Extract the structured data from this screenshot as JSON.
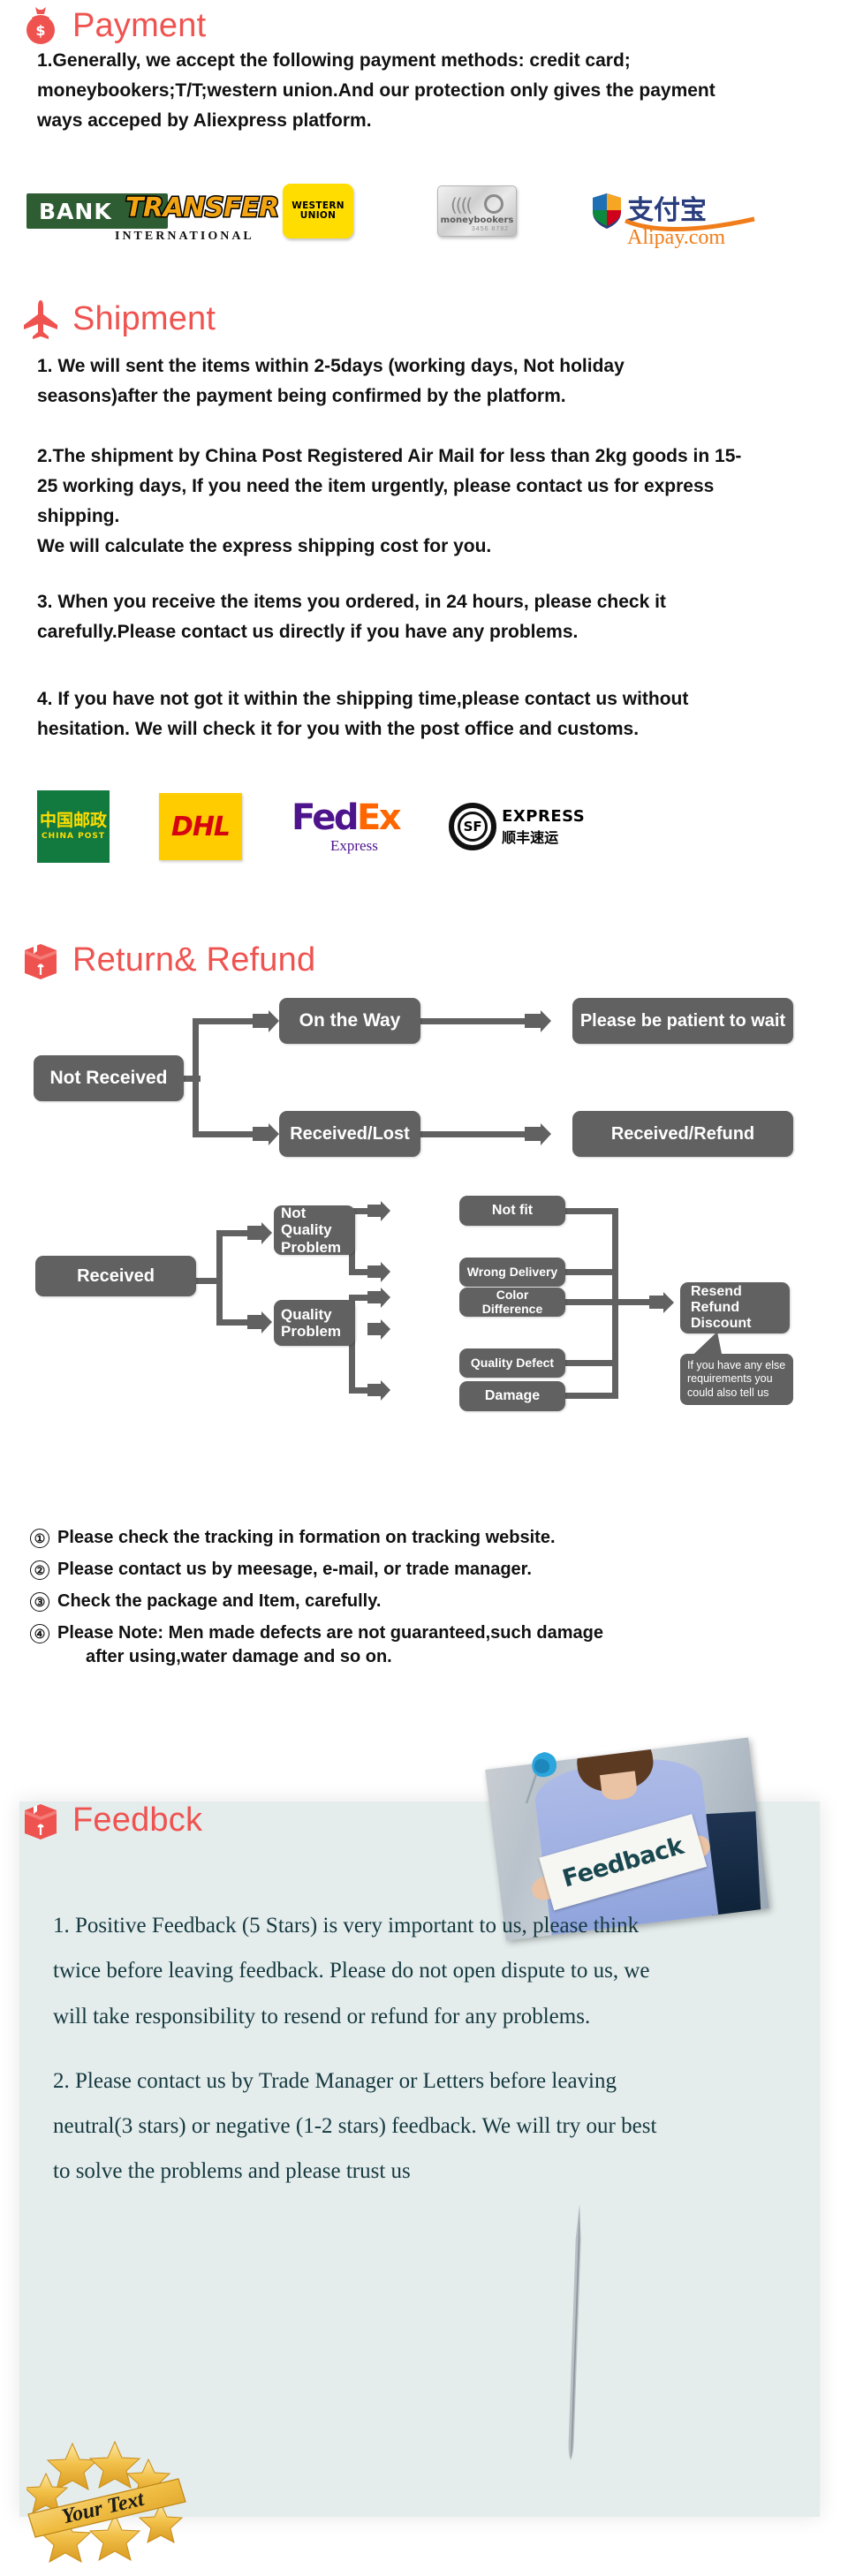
{
  "brand": {
    "accent": "#ef5350",
    "node_fill": "#616161",
    "feedback_card_bg": "#e4ecec",
    "feedback_text_color": "#15393f"
  },
  "sections": {
    "payment": {
      "title": "Payment",
      "icon": "money-bag-icon",
      "paragraph": "1.Generally, we accept the following payment methods: credit card; moneybookers;T/T;western union.And our protection only gives the payment ways acceped by Aliexpress platform.",
      "logos": [
        {
          "name": "bank-transfer-logo",
          "primary": "BANK",
          "secondary": "TRANSFER",
          "sub": "INTERNATIONAL"
        },
        {
          "name": "western-union-logo",
          "line1": "WESTERN",
          "line2": "UNION"
        },
        {
          "name": "moneybookers-logo",
          "label": "moneybookers",
          "number": "3456 8792"
        },
        {
          "name": "alipay-logo",
          "cn": "支付宝",
          "latin": "Alipay.com"
        }
      ]
    },
    "shipment": {
      "title": "Shipment",
      "icon": "airplane-icon",
      "paragraphs": [
        "1. We will sent the items within 2-5days (working days, Not holiday seasons)after the payment being confirmed by the platform.",
        "2.The shipment by China Post Registered Air Mail for less than  2kg goods in 15-25 working days, If  you need the item urgently, please contact us for express shipping.\nWe will calculate the express shipping cost for you.",
        "3. When you receive the items you ordered, in 24 hours, please check it carefully.Please contact us directly if you have any problems.",
        "4. If you have not got it within the shipping time,please contact us without hesitation. We will check it for you with the post office and customs."
      ],
      "carriers": [
        {
          "name": "china-post-logo",
          "cn": "中国邮政",
          "en": "CHINA POST"
        },
        {
          "name": "dhl-logo",
          "text": "DHL"
        },
        {
          "name": "fedex-logo",
          "part1": "Fed",
          "part2": "Ex",
          "sub": "Express"
        },
        {
          "name": "sf-express-logo",
          "mark": "SF",
          "en": "EXPRESS",
          "cn": "顺丰速运"
        }
      ]
    },
    "return_refund": {
      "title": "Return& Refund",
      "icon": "return-box-icon",
      "chart_data": {
        "type": "diagram",
        "title": "Return & Refund decision flow",
        "flows": [
          {
            "root": "Not Received",
            "branches": [
              {
                "node": "On the Way",
                "result": "Please be patient to wait"
              },
              {
                "node": "Received/Lost",
                "result": "Received/Refund"
              }
            ]
          },
          {
            "root": "Received",
            "branches": [
              {
                "node": "Not Quality Problem",
                "leaves": [
                  "Not fit",
                  "Wrong Delivery"
                ]
              },
              {
                "node": "Quality Problem",
                "leaves": [
                  "Color Difference",
                  "Quality Defect",
                  "Damage"
                ]
              }
            ],
            "result": "Resend\nRefund\nDiscount",
            "callout": "If you have any else requirements you could also tell us"
          }
        ]
      },
      "nodes": {
        "not_received": "Not Received",
        "on_the_way": "On the Way",
        "please_wait": "Please be patient to wait",
        "received_lost": "Received/Lost",
        "received_refund": "Received/Refund",
        "received": "Received",
        "not_quality_problem": "Not\nQuality\nProblem",
        "quality_problem": "Quality\nProblem",
        "not_fit": "Not fit",
        "wrong_delivery": "Wrong Delivery",
        "color_difference": "Color Difference",
        "quality_defect": "Quality Defect",
        "damage": "Damage",
        "resend_refund_discount": "Resend\nRefund\nDiscount",
        "callout": "If you have any else requirements you could also tell us"
      },
      "list": [
        {
          "num": "①",
          "text": "Please check the tracking in formation on tracking website."
        },
        {
          "num": "②",
          "text": "Please contact us by meesage, e-mail, or trade manager."
        },
        {
          "num": "③",
          "text": "Check the package and Item, carefully."
        },
        {
          "num": "④",
          "text": "Please Note: Men made defects  are not guaranteed,such damage",
          "cont": "after using,water damage and so on."
        }
      ]
    },
    "feedback": {
      "title": "Feedbck",
      "icon": "feedback-box-icon",
      "photo_sign_text": "Feedback",
      "paragraphs": [
        "1. Positive Feedback (5 Stars) is very important to us, please think twice before leaving feedback. Please do not open dispute to us,   we will take responsibility to resend or refund for any problems.",
        "2. Please contact us by Trade Manager or Letters before leaving neutral(3 stars) or negative (1-2 stars) feedback. We will try our best to solve the problems and please trust us"
      ],
      "badge_text": "Your Text"
    }
  }
}
